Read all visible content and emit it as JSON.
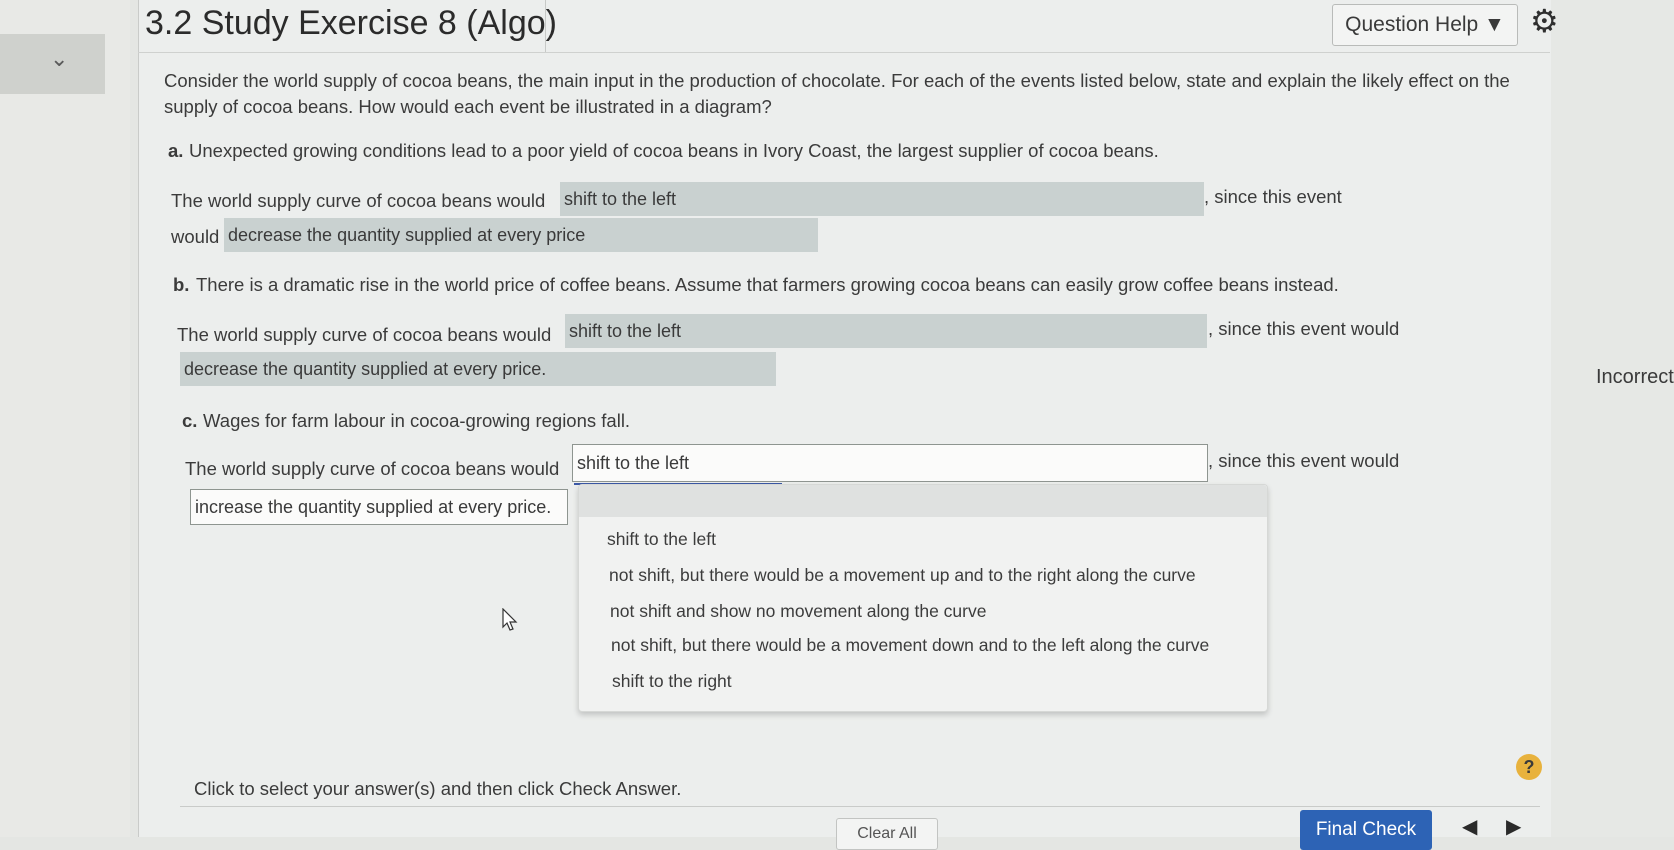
{
  "header": {
    "title": "3.2 Study Exercise 8 (Algo)",
    "question_help": "Question Help ▼",
    "settings_icon": "gear-icon"
  },
  "left_rail": {
    "toggle_icon": "chevron-down-icon"
  },
  "question": {
    "intro_line1": "Consider the world supply of cocoa beans, the main input in the production of chocolate. For each of the events listed below, state and explain the likely effect on the",
    "intro_line2": "supply of cocoa beans. How would each event be illustrated in a diagram?",
    "parts": [
      {
        "letter": "a.",
        "event": "Unexpected growing conditions lead to a poor yield of cocoa beans in Ivory Coast, the largest supplier of cocoa beans.",
        "prefix": "The world supply curve of cocoa beans would",
        "answer1": "shift to the left",
        "middle": ", since this event",
        "cont": "would",
        "answer2": "decrease the quantity supplied at every price"
      },
      {
        "letter": "b.",
        "event": "There is a dramatic rise in the world price of coffee beans. Assume that farmers growing cocoa beans can easily grow coffee beans instead.",
        "prefix": "The world supply curve of cocoa beans would",
        "answer1": "shift to the left",
        "middle": ", since this event would",
        "answer2": "decrease the quantity supplied at every price."
      },
      {
        "letter": "c.",
        "event": "Wages for farm labour in cocoa-growing regions fall.",
        "prefix": "The world supply curve of cocoa beans would",
        "answer1": "shift to the left",
        "middle": ", since this event would",
        "answer2": "increase the quantity supplied at every price."
      }
    ]
  },
  "dropdown": {
    "options": [
      "shift to the left",
      "not shift, but there would be a movement up and to the right along the curve",
      "not shift and show no movement along the curve",
      "not shift, but there would be a movement down and to the left along the curve",
      "shift to the right"
    ]
  },
  "status": {
    "incorrect": "Incorrect"
  },
  "footer": {
    "instruction": "Click to select your answer(s) and then click Check Answer.",
    "help": "?",
    "clear_all": "Clear All",
    "final_check": "Final Check",
    "prev": "◀",
    "next": "▶"
  }
}
